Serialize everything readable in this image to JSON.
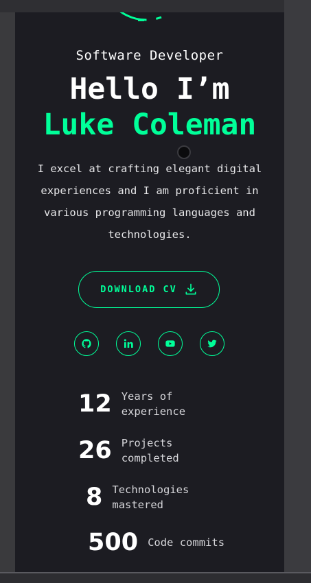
{
  "hero": {
    "role": "Software Developer",
    "greeting": "Hello I’m",
    "name": "Luke Coleman",
    "intro": "I excel at crafting elegant digital experiences and I am proficient in various programming languages and technologies.",
    "download_label": "DOWNLOAD CV"
  },
  "socials": [
    {
      "icon": "github-icon",
      "name": "GitHub"
    },
    {
      "icon": "linkedin-icon",
      "name": "LinkedIn"
    },
    {
      "icon": "youtube-icon",
      "name": "YouTube"
    },
    {
      "icon": "twitter-icon",
      "name": "Twitter"
    }
  ],
  "stats": [
    {
      "value": "12",
      "label": "Years of experience"
    },
    {
      "value": "26",
      "label": "Projects completed"
    },
    {
      "value": "8",
      "label": "Technologies mastered"
    },
    {
      "value": "500",
      "label": "Code commits"
    }
  ],
  "colors": {
    "accent": "#00ff99",
    "background": "#1c1c22",
    "text": "#ffffff"
  }
}
